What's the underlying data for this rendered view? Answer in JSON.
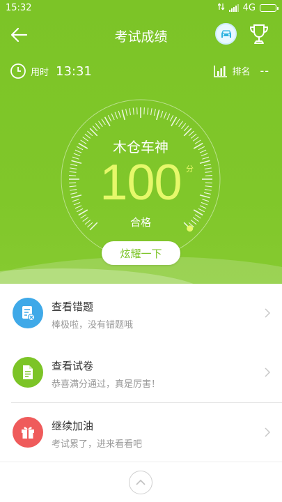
{
  "status_bar": {
    "time": "15:32",
    "network": "4G"
  },
  "header": {
    "title": "考试成绩"
  },
  "stats": {
    "time_label": "用时",
    "time_value": "13:31",
    "rank_label": "排名",
    "rank_value": "--"
  },
  "result": {
    "rank_title": "木仓车神",
    "score": "100",
    "score_unit": "分",
    "status": "合格",
    "share_label": "炫耀一下"
  },
  "actions": [
    {
      "title": "查看错题",
      "subtitle": "棒极啦，没有错题哦",
      "icon": "wrong-answers-icon",
      "color": "#3fa9e8"
    },
    {
      "title": "查看试卷",
      "subtitle": "恭喜满分通过，真是厉害！",
      "icon": "document-icon",
      "color": "#7cc427"
    },
    {
      "title": "继续加油",
      "subtitle": "考试累了，进来看看吧",
      "icon": "gift-icon",
      "color": "#ef5b5b"
    }
  ],
  "colors": {
    "brand_green": "#7cc427",
    "score_yellow": "#e6f86a"
  }
}
